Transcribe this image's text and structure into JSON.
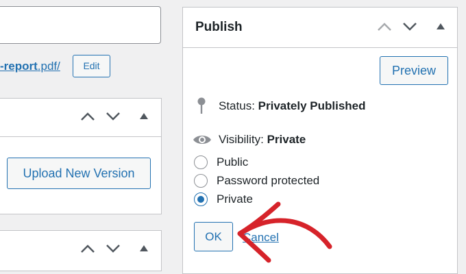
{
  "editor": {
    "permalink_slug_bold": "-report",
    "permalink_slug_tail": ".pdf/",
    "edit_button": "Edit"
  },
  "document_panel": {
    "upload_button": "Upload New Version"
  },
  "publish": {
    "title": "Publish",
    "preview_button": "Preview",
    "status_label": "Status:",
    "status_value": "Privately Published",
    "visibility_label": "Visibility:",
    "visibility_value": "Private",
    "options": [
      {
        "label": "Public",
        "checked": false
      },
      {
        "label": "Password protected",
        "checked": false
      },
      {
        "label": "Private",
        "checked": true
      }
    ],
    "ok_button": "OK",
    "cancel_link": "Cancel"
  },
  "colors": {
    "accent": "#2271b1",
    "annotation": "#d6232a"
  },
  "icons": [
    "chevron-up-icon",
    "chevron-down-icon",
    "triangle-up-icon",
    "pin-icon",
    "eye-icon",
    "arrow-annotation"
  ]
}
